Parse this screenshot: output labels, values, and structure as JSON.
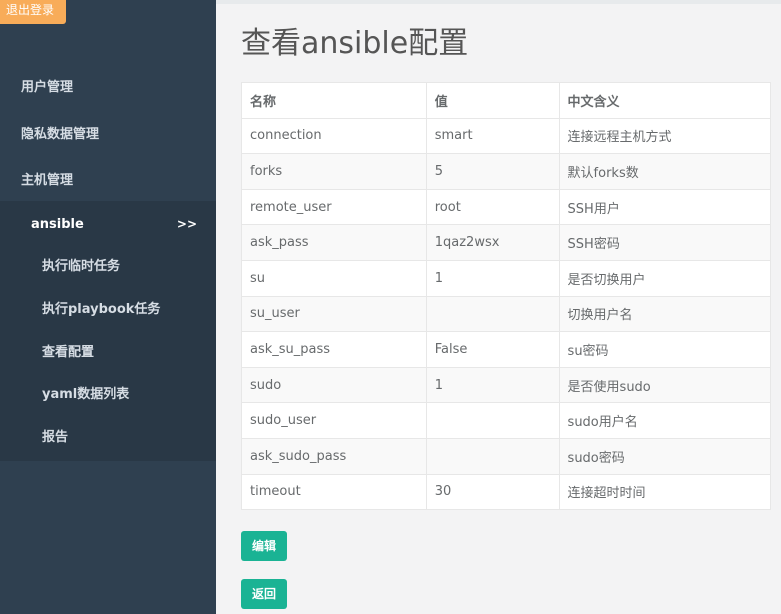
{
  "logout_label": "退出登录",
  "sidebar": {
    "items": [
      {
        "label": "用户管理"
      },
      {
        "label": "隐私数据管理"
      },
      {
        "label": "主机管理"
      }
    ],
    "submenu": {
      "title": "ansible",
      "arrow": ">>",
      "items": [
        {
          "label": "执行临时任务"
        },
        {
          "label": "执行playbook任务"
        },
        {
          "label": "查看配置"
        },
        {
          "label": "yaml数据列表"
        },
        {
          "label": "报告"
        }
      ]
    }
  },
  "main": {
    "title": "查看ansible配置",
    "table": {
      "headers": [
        "名称",
        "值",
        "中文含义"
      ],
      "rows": [
        [
          "connection",
          "smart",
          "连接远程主机方式"
        ],
        [
          "forks",
          "5",
          "默认forks数"
        ],
        [
          "remote_user",
          "root",
          "SSH用户"
        ],
        [
          "ask_pass",
          "1qaz2wsx",
          "SSH密码"
        ],
        [
          "su",
          "1",
          "是否切换用户"
        ],
        [
          "su_user",
          "",
          "切换用户名"
        ],
        [
          "ask_su_pass",
          "False",
          "su密码"
        ],
        [
          "sudo",
          "1",
          "是否使用sudo"
        ],
        [
          "sudo_user",
          "",
          "sudo用户名"
        ],
        [
          "ask_sudo_pass",
          "",
          "sudo密码"
        ],
        [
          "timeout",
          "30",
          "连接超时时间"
        ]
      ]
    },
    "edit_label": "编辑",
    "back_label": "返回"
  },
  "colors": {
    "sidebar": "#2f4050",
    "submenu_bg": "#293846",
    "logout": "#f8ac59",
    "primary_button": "#1ab394"
  }
}
